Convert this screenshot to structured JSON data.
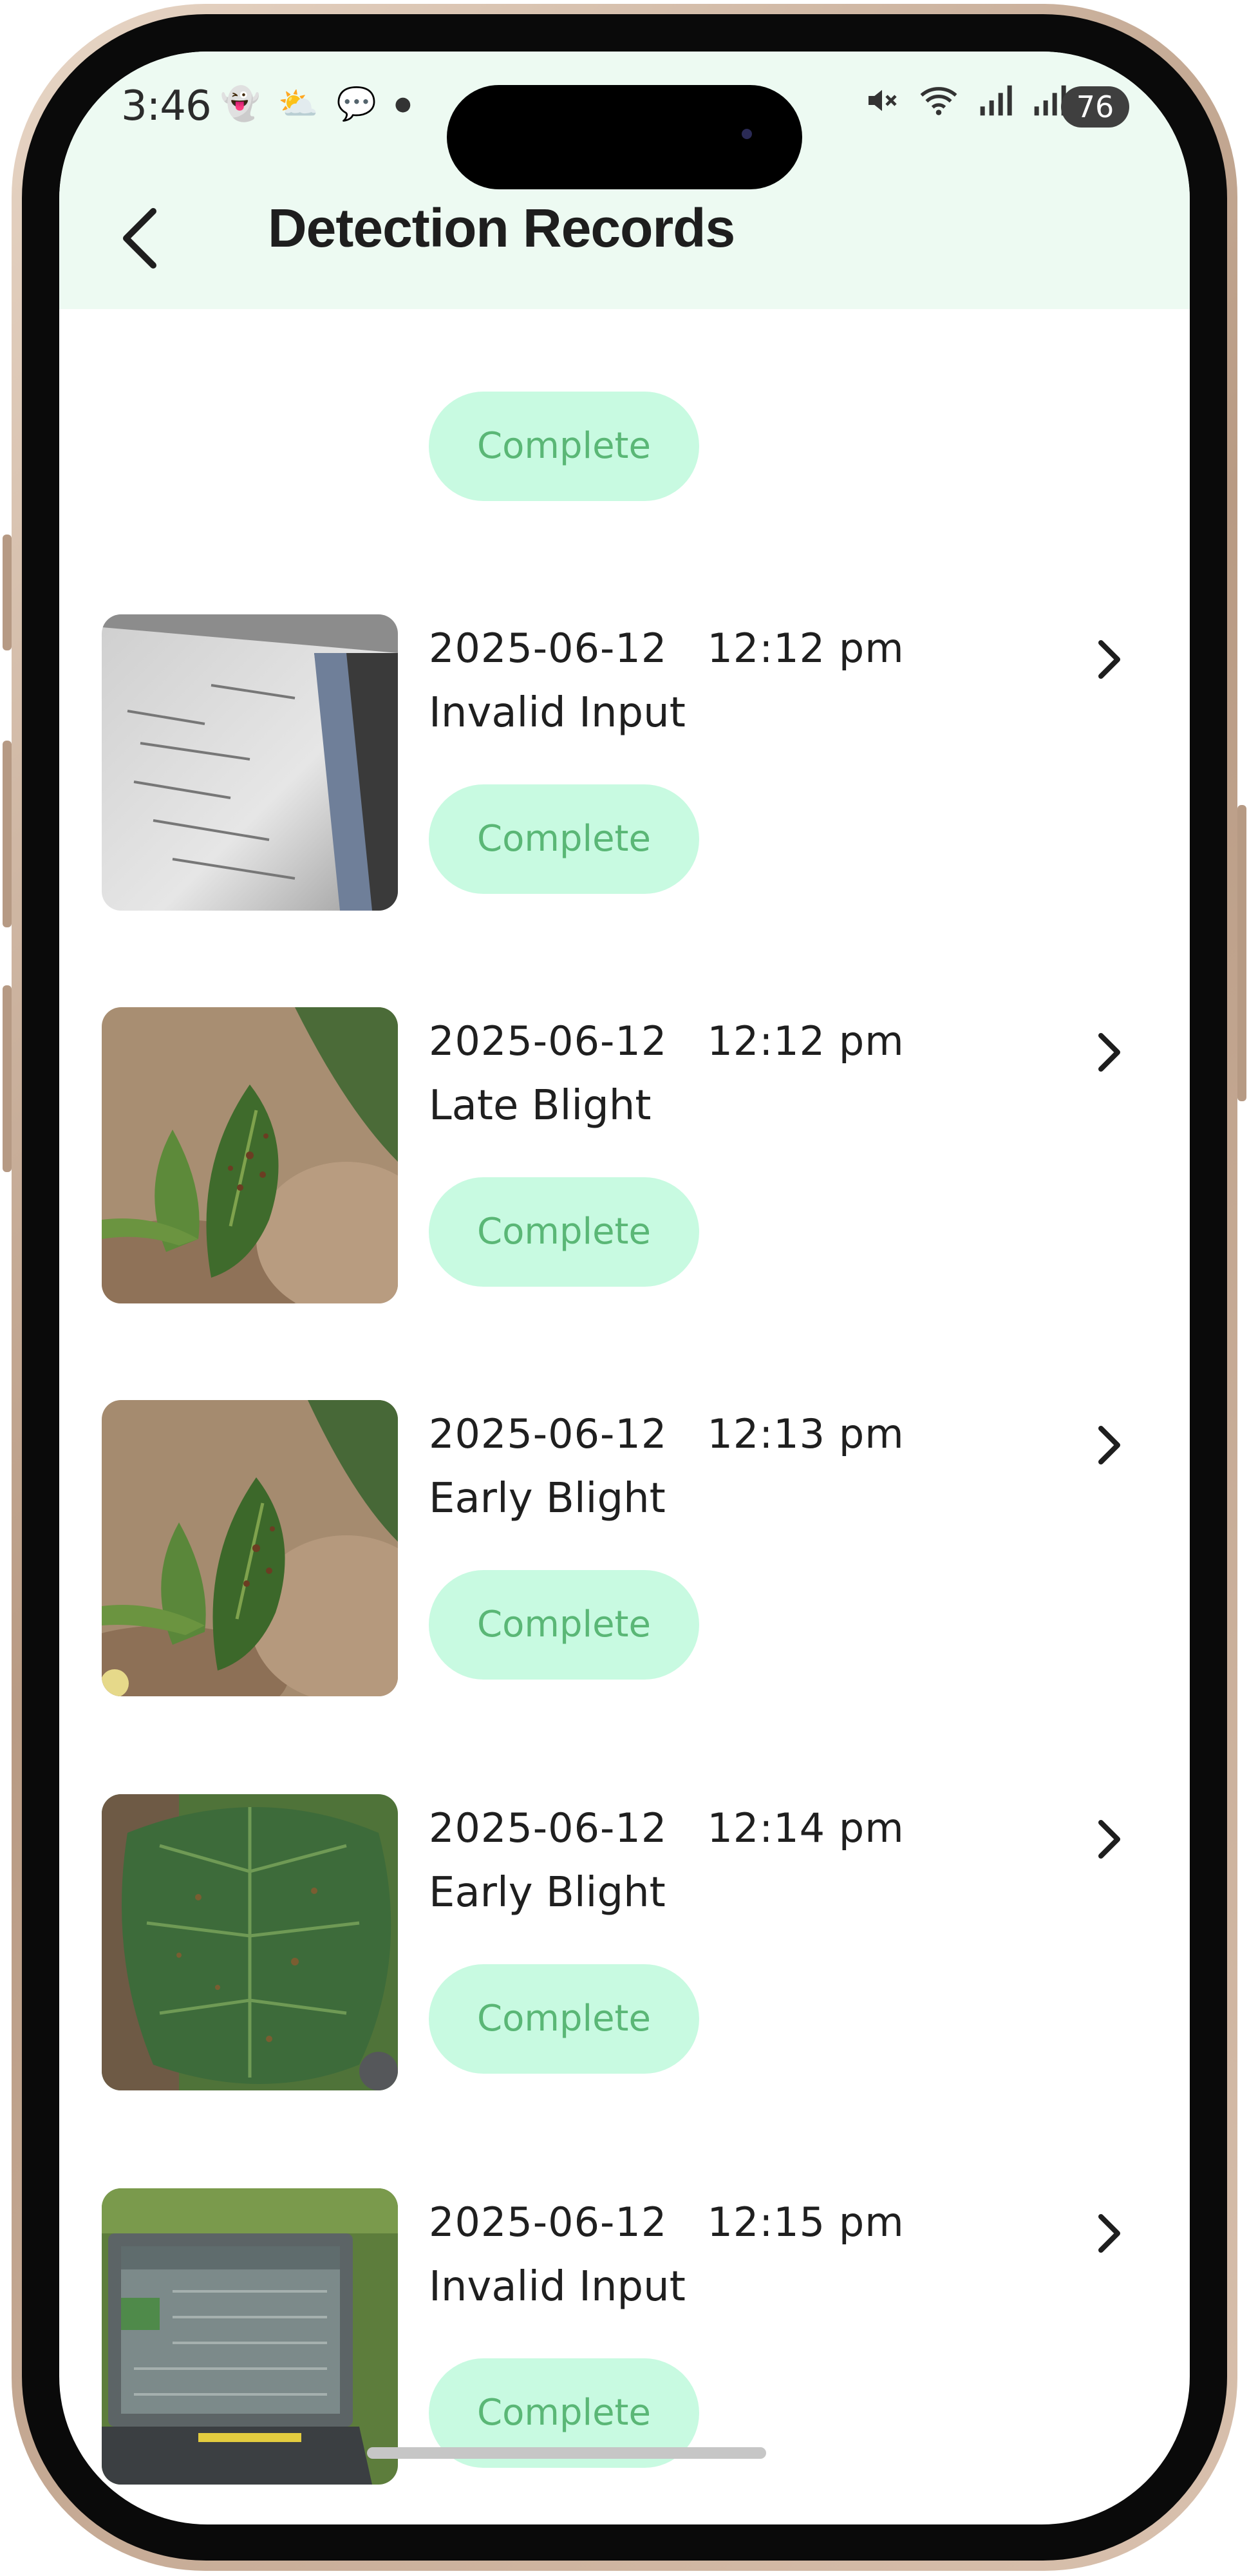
{
  "status_bar": {
    "time": "3:46",
    "battery": "76",
    "left_icons": [
      "snapchat-icon",
      "weather-icon",
      "chat-icon",
      "dot-icon"
    ],
    "right_icons": [
      "mute-icon",
      "wifi-icon",
      "signal-icon",
      "signal-icon"
    ]
  },
  "header": {
    "title": "Detection Records"
  },
  "colors": {
    "header_bg": "#edfaf2",
    "badge_bg": "#c8fae1",
    "badge_text": "#5ab776",
    "text": "#1f1f1f"
  },
  "top_partial": {
    "status": "Complete"
  },
  "records": [
    {
      "date": "2025-06-12",
      "time": "12:12 pm",
      "label": "Invalid Input",
      "status": "Complete",
      "thumb": "laptop-screen-photo"
    },
    {
      "date": "2025-06-12",
      "time": "12:12 pm",
      "label": "Late Blight",
      "status": "Complete",
      "thumb": "potato-leaf-photo"
    },
    {
      "date": "2025-06-12",
      "time": "12:13 pm",
      "label": "Early Blight",
      "status": "Complete",
      "thumb": "potato-leaf-photo"
    },
    {
      "date": "2025-06-12",
      "time": "12:14 pm",
      "label": "Early Blight",
      "status": "Complete",
      "thumb": "large-leaf-photo"
    },
    {
      "date": "2025-06-12",
      "time": "12:15 pm",
      "label": "Invalid Input",
      "status": "Complete",
      "thumb": "laptop-in-field-photo"
    }
  ]
}
